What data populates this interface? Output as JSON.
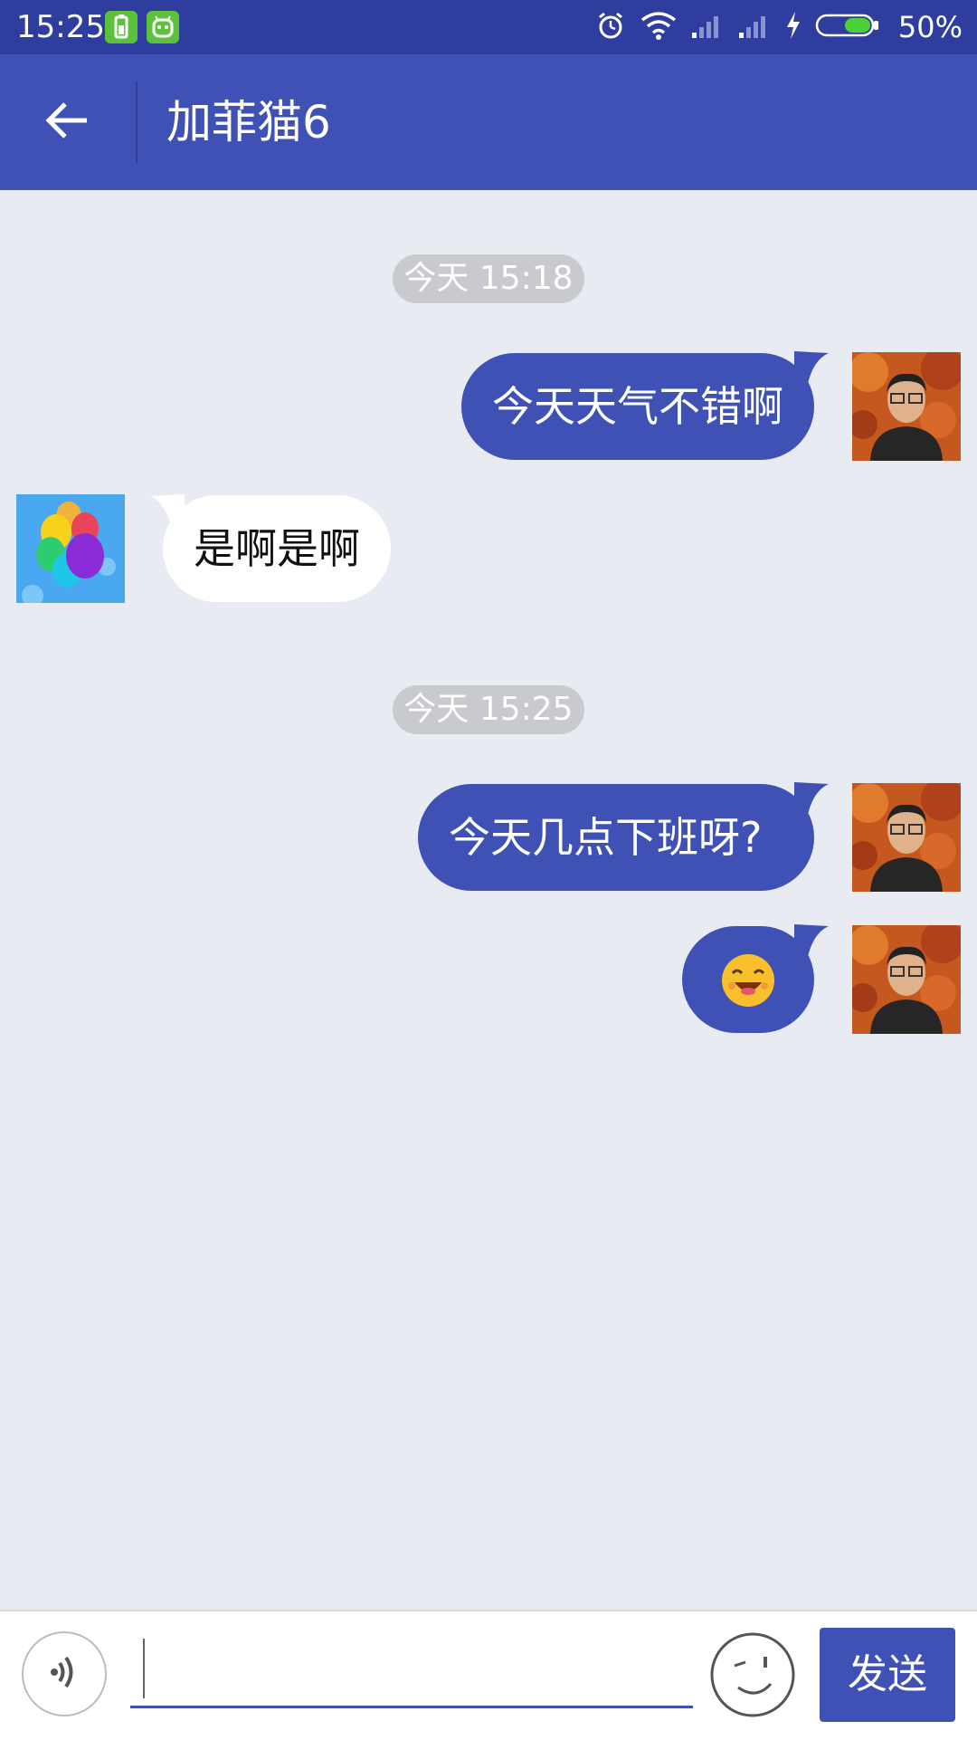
{
  "status_bar": {
    "time": "15:25",
    "battery_percent": "50%",
    "battery_level": 0.5
  },
  "header": {
    "title": "加菲猫6"
  },
  "chat": {
    "timestamps": [
      "今天 15:18",
      "今天 15:25"
    ],
    "messages": [
      {
        "direction": "out",
        "text": "今天天气不错啊"
      },
      {
        "direction": "in",
        "text": "是啊是啊"
      },
      {
        "direction": "out",
        "text": "今天几点下班呀?"
      },
      {
        "direction": "out",
        "text": "",
        "emoji": "smiling-face-emoji"
      }
    ]
  },
  "input_bar": {
    "input_value": "",
    "send_label": "发送"
  },
  "colors": {
    "primary": "#3f51b5",
    "primary_dark": "#2f3e9e",
    "chat_background": "#e8ebf1",
    "timestamp_pill": "#c8cacd",
    "battery_green": "#4cd137"
  }
}
